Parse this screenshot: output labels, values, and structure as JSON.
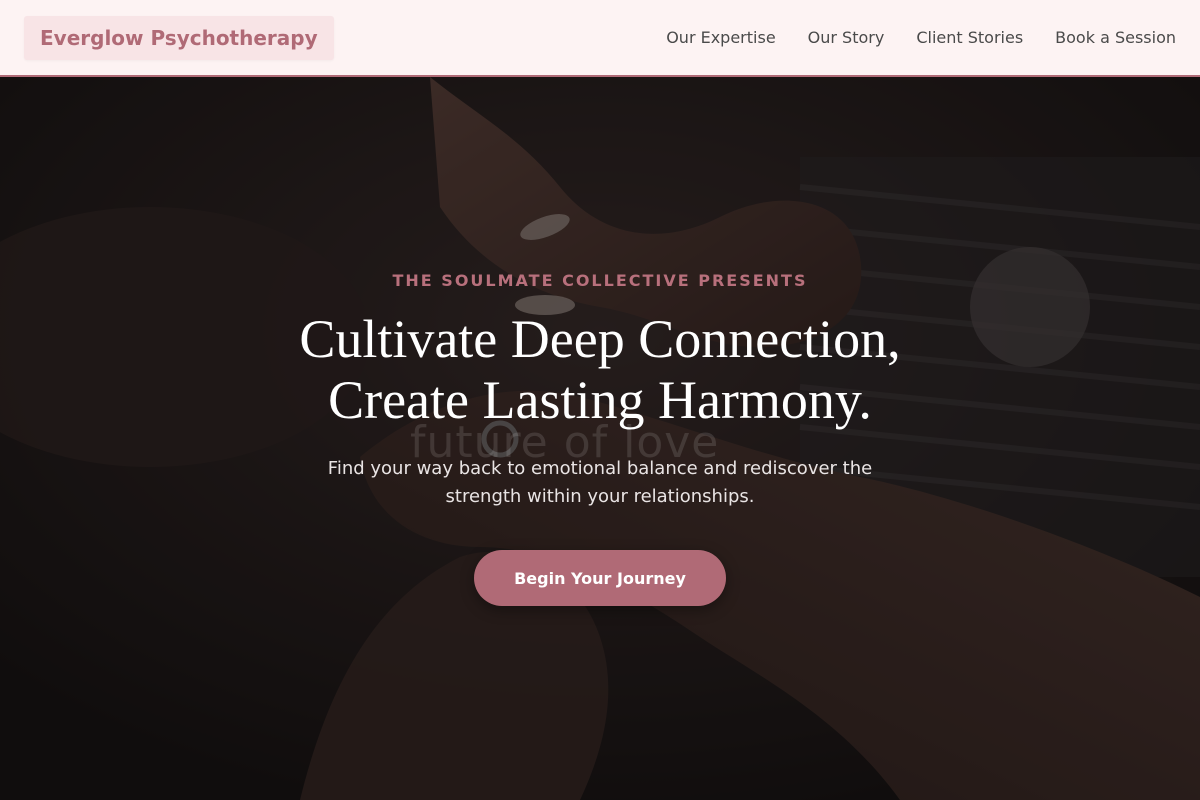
{
  "header": {
    "brand": "Everglow Psychotherapy",
    "nav": [
      {
        "label": "Our Expertise"
      },
      {
        "label": "Our Story"
      },
      {
        "label": "Client Stories"
      },
      {
        "label": "Book a Session"
      }
    ]
  },
  "hero": {
    "eyebrow": "THE SOULMATE COLLECTIVE PRESENTS",
    "headline_line1": "Cultivate Deep Connection,",
    "headline_line2": "Create Lasting Harmony.",
    "subhead": "Find your way back to emotional balance and rediscover the strength within your relationships.",
    "cta_label": "Begin Your Journey",
    "photo_watermark": "future of love"
  },
  "colors": {
    "accent": "#b06a76",
    "header_bg": "#fdf3f3",
    "eyebrow": "#b8707c",
    "nav_text": "#4a4a4a",
    "hero_text": "#ffffff"
  }
}
